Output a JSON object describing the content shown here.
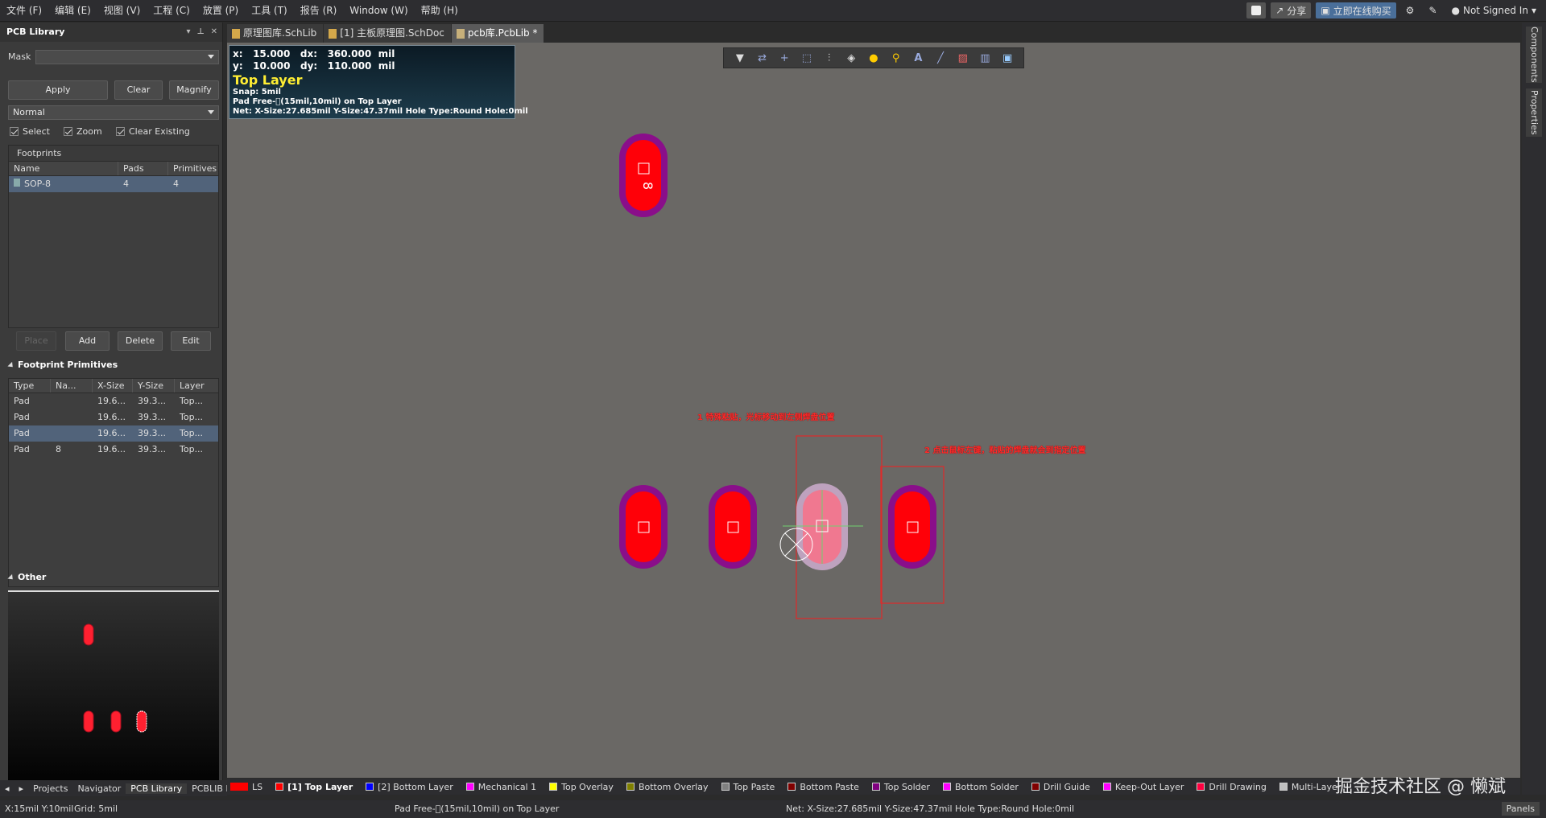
{
  "menu": [
    "文件 (F)",
    "编辑 (E)",
    "视图 (V)",
    "工程 (C)",
    "放置 (P)",
    "工具 (T)",
    "报告 (R)",
    "Window (W)",
    "帮助 (H)"
  ],
  "top_right": {
    "share": "分享",
    "buy": "立即在线购买",
    "user": "Not Signed In"
  },
  "left_panel": {
    "title": "PCB Library",
    "mask_label": "Mask",
    "mask_value": "",
    "apply": "Apply",
    "clear": "Clear",
    "magnify": "Magnify",
    "mode": "Normal",
    "select": "Select",
    "zoom": "Zoom",
    "clear_existing": "Clear Existing",
    "footprints_label": "Footprints",
    "fp_headers": [
      "Name",
      "Pads",
      "Primitives"
    ],
    "fp_rows": [
      {
        "name": "SOP-8",
        "pads": "4",
        "prims": "4"
      }
    ],
    "place": "Place",
    "add": "Add",
    "delete": "Delete",
    "edit": "Edit",
    "primitives_label": "Footprint Primitives",
    "prim_headers": [
      "Type",
      "Na...",
      "X-Size",
      "Y-Size",
      "Layer"
    ],
    "prim_rows": [
      {
        "type": "Pad",
        "name": "",
        "x": "19.6...",
        "y": "39.3...",
        "layer": "Top..."
      },
      {
        "type": "Pad",
        "name": "",
        "x": "19.6...",
        "y": "39.3...",
        "layer": "Top..."
      },
      {
        "type": "Pad",
        "name": "",
        "x": "19.6...",
        "y": "39.3...",
        "layer": "Top..."
      },
      {
        "type": "Pad",
        "name": "8",
        "x": "19.6...",
        "y": "39.3...",
        "layer": "Top..."
      }
    ],
    "other_label": "Other"
  },
  "bottom_tabs": [
    "Projects",
    "Navigator",
    "PCB Library",
    "PCBLIB Fi"
  ],
  "doc_tabs": [
    "原理图库.SchLib",
    "[1] 主板原理图.SchDoc",
    "pcb库.PcbLib *"
  ],
  "info": {
    "line1": "x:   15.000   dx:   360.000  mil",
    "line2": "y:   10.000   dy:   110.000  mil",
    "layer": "Top Layer",
    "snap": "Snap: 5mil",
    "pad": "Pad Free-\u0000(15mil,10mil) on Top Layer",
    "net": "Net: X-Size:27.685mil Y-Size:47.37mil Hole Type:Round Hole:0mil"
  },
  "canvas": {
    "pad_label": "8",
    "annot1": "1 特殊粘贴，光标移动到左侧焊盘位置",
    "annot2": "2 点击鼠标左键，粘贴的焊盘就会到指定位置"
  },
  "right_tabs": [
    "Components",
    "Properties"
  ],
  "layers": [
    {
      "label": "LS",
      "color": "#ff0000"
    },
    {
      "label": "[1] Top Layer",
      "color": "#ff0000"
    },
    {
      "label": "[2] Bottom Layer",
      "color": "#0000ff"
    },
    {
      "label": "Mechanical 1",
      "color": "#ff00ff"
    },
    {
      "label": "Top Overlay",
      "color": "#ffff00"
    },
    {
      "label": "Bottom Overlay",
      "color": "#808000"
    },
    {
      "label": "Top Paste",
      "color": "#808080"
    },
    {
      "label": "Bottom Paste",
      "color": "#800000"
    },
    {
      "label": "Top Solder",
      "color": "#800080"
    },
    {
      "label": "Bottom Solder",
      "color": "#ff00ff"
    },
    {
      "label": "Drill Guide",
      "color": "#800000"
    },
    {
      "label": "Keep-Out Layer",
      "color": "#ff00ff"
    },
    {
      "label": "Drill Drawing",
      "color": "#ff0040"
    },
    {
      "label": "Multi-Layer",
      "color": "#c0c0c0"
    }
  ],
  "watermark": "掘金技术社区 @ 懒斌",
  "status": {
    "coords": "X:15mil Y:10mil",
    "grid": "Grid: 5mil",
    "pad": "Pad Free-\u0000(15mil,10mil) on Top Layer",
    "net": "Net: X-Size:27.685mil Y-Size:47.37mil Hole Type:Round Hole:0mil",
    "panels": "Panels"
  }
}
